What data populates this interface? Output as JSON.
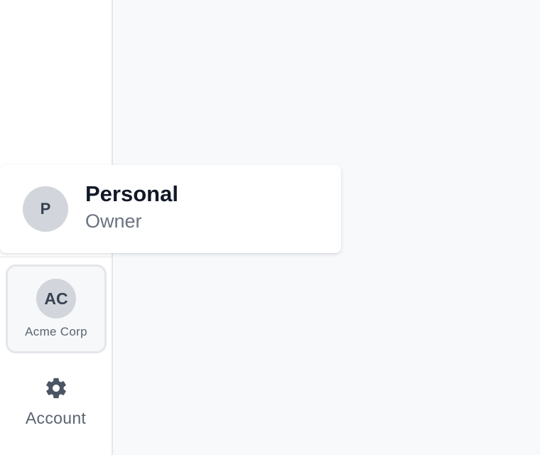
{
  "sidebar": {
    "org": {
      "initials": "AC",
      "name": "Acme Corp"
    },
    "account": {
      "label": "Account",
      "icon": "gear-icon"
    }
  },
  "popover": {
    "avatar_initial": "P",
    "title": "Personal",
    "subtitle": "Owner"
  },
  "colors": {
    "sidebar_bg": "#ffffff",
    "main_bg": "#f8f9fb",
    "avatar_bg": "#d2d5db",
    "text_primary": "#111827",
    "text_muted": "#6b7280",
    "icon": "#4b5563"
  }
}
